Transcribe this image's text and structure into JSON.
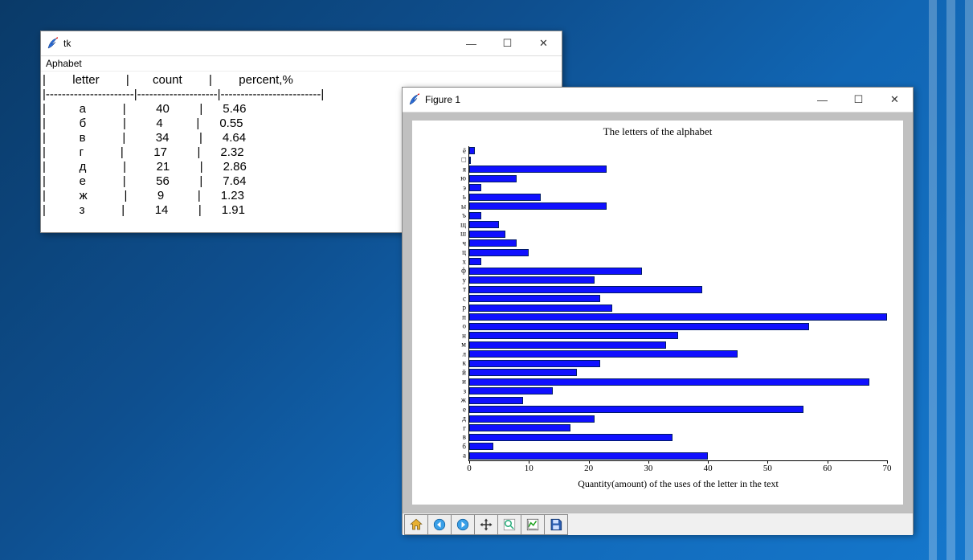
{
  "tk_window": {
    "title": "tk",
    "menu": "Aphabet",
    "header": {
      "letter": "letter",
      "count": "count",
      "percent": "percent,%"
    },
    "rows": [
      {
        "letter": "а",
        "count": "40",
        "percent": "5.46"
      },
      {
        "letter": "б",
        "count": "4",
        "percent": "0.55"
      },
      {
        "letter": "в",
        "count": "34",
        "percent": "4.64"
      },
      {
        "letter": "г",
        "count": "17",
        "percent": "2.32"
      },
      {
        "letter": "д",
        "count": "21",
        "percent": "2.86"
      },
      {
        "letter": "е",
        "count": "56",
        "percent": "7.64"
      },
      {
        "letter": "ж",
        "count": "9",
        "percent": "1.23"
      },
      {
        "letter": "з",
        "count": "14",
        "percent": "1.91"
      }
    ]
  },
  "figure_window": {
    "title": "Figure 1"
  },
  "chart_data": {
    "type": "bar",
    "orientation": "horizontal",
    "title": "The letters of the alphabet",
    "xlabel": "Quantity(amount) of the uses of the letter in the text",
    "ylabel": "",
    "xlim": [
      0,
      70
    ],
    "xticks": [
      0,
      10,
      20,
      30,
      40,
      50,
      60,
      70
    ],
    "categories": [
      "а",
      "б",
      "в",
      "г",
      "д",
      "е",
      "ж",
      "з",
      "и",
      "й",
      "к",
      "л",
      "м",
      "н",
      "о",
      "п",
      "р",
      "с",
      "т",
      "у",
      "ф",
      "х",
      "ц",
      "ч",
      "ш",
      "щ",
      "ъ",
      "ы",
      "ь",
      "э",
      "ю",
      "я",
      "□",
      "ё"
    ],
    "values": [
      40,
      4,
      34,
      17,
      21,
      56,
      9,
      14,
      67,
      18,
      22,
      45,
      33,
      35,
      57,
      70,
      24,
      22,
      39,
      21,
      29,
      2,
      10,
      8,
      6,
      5,
      2,
      23,
      12,
      2,
      8,
      23,
      0,
      1
    ]
  },
  "toolbar": {
    "home": "Home",
    "back": "Back",
    "forward": "Forward",
    "pan": "Pan",
    "zoom": "Zoom",
    "subplots": "Configure subplots",
    "save": "Save"
  }
}
